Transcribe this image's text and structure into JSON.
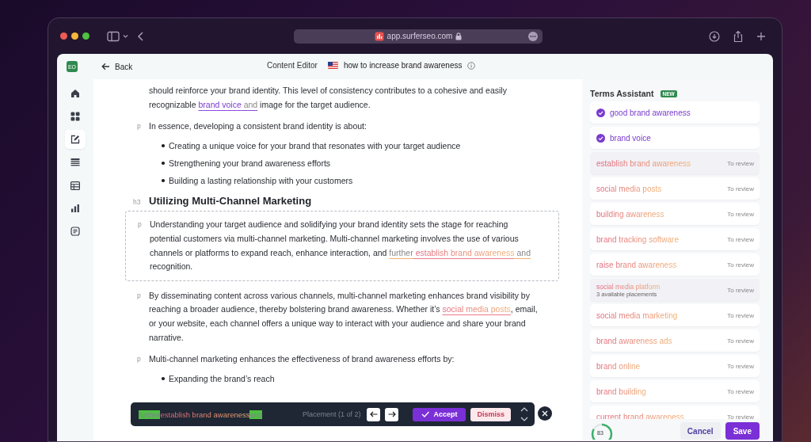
{
  "browser": {
    "url": "app.surferseo.com"
  },
  "header": {
    "badge": "EO",
    "back": "Back",
    "section": "Content Editor",
    "document_title": "how to increase brand awareness"
  },
  "sidebar": {
    "items": [
      {
        "selected": false
      },
      {
        "selected": false
      },
      {
        "selected": true
      },
      {
        "selected": false
      },
      {
        "selected": false
      },
      {
        "selected": false
      },
      {
        "selected": false
      }
    ]
  },
  "editor": {
    "blocks": [
      {
        "kind": "paragraph",
        "focused": false,
        "parts": [
          {
            "text": "should reinforce your brand identity. This level of consistency contributes to a cohesive and easily recognizable ",
            "kind": "plain"
          },
          {
            "text": "brand voice",
            "kind": "accepted"
          },
          {
            "text": " and",
            "kind": "acceptedtail"
          },
          {
            "text": " image for the target audience.",
            "kind": "plain"
          }
        ]
      },
      {
        "kind": "paragraph",
        "tag": "p",
        "focused": false,
        "parts": [
          {
            "text": "In essence, developing a consistent brand identity is about:",
            "kind": "plain"
          }
        ]
      },
      {
        "kind": "list",
        "items": [
          "Creating a unique voice for your brand that resonates with your target audience",
          "Strengthening your brand awareness efforts",
          "Building a lasting relationship with your customers"
        ]
      },
      {
        "kind": "heading",
        "tag": "h3",
        "text": "Utilizing Multi-Channel Marketing"
      },
      {
        "kind": "paragraph",
        "tag": "p",
        "focused": true,
        "parts": [
          {
            "text": "Understanding your target audience and solidifying your brand identity sets the stage for reaching potential customers via multi-channel marketing. Multi-channel marketing involves the use of various channels or platforms to expand reach, enhance interaction, and ",
            "kind": "plain"
          },
          {
            "text": "further",
            "kind": "suggestedtail"
          },
          {
            "text": " establish brand awareness",
            "kind": "suggested"
          },
          {
            "text": " and",
            "kind": "suggestedtail"
          },
          {
            "text": " recognition.",
            "kind": "plain"
          }
        ]
      },
      {
        "kind": "paragraph",
        "tag": "p",
        "focused": false,
        "parts": [
          {
            "text": "By disseminating content across various channels, multi-channel marketing enhances brand visibility by reaching a broader audience, thereby bolstering brand awareness. Whether it’s ",
            "kind": "plain"
          },
          {
            "text": "social media posts",
            "kind": "suggested"
          },
          {
            "text": ", email, or your website, each channel offers a unique way to interact with your audience and share your brand narrative.",
            "kind": "plain"
          }
        ]
      },
      {
        "kind": "paragraph",
        "tag": "p",
        "focused": false,
        "parts": [
          {
            "text": "Multi-channel marketing enhances the effectiveness of brand awareness efforts by:",
            "kind": "plain"
          }
        ]
      },
      {
        "kind": "list",
        "items": [
          "Expanding the brand’s reach"
        ]
      }
    ]
  },
  "placement_bar": {
    "before": "further",
    "term": "establish brand awareness",
    "after": "and",
    "placement": "Placement (1 of 2)",
    "accept": "Accept",
    "dismiss": "Dismiss"
  },
  "terms_assistant": {
    "title": "Terms Assistant",
    "badge": "NEW",
    "terms": [
      {
        "text": "good brand awareness",
        "done": true,
        "selected": false
      },
      {
        "text": "brand voice",
        "done": true,
        "selected": false
      },
      {
        "text": "establish brand awareness",
        "done": false,
        "selected": true,
        "status": "To review"
      },
      {
        "text": "social media posts",
        "done": false,
        "selected": false,
        "status": "To review"
      },
      {
        "text": "building awareness",
        "done": false,
        "selected": false,
        "status": "To review"
      },
      {
        "text": "brand tracking software",
        "done": false,
        "selected": false,
        "status": "To review"
      },
      {
        "text": "raise brand awareness",
        "done": false,
        "selected": false,
        "status": "To review"
      },
      {
        "text": "social media platform",
        "subtitle": "3 available placements",
        "done": false,
        "selected": true,
        "status": "To review"
      },
      {
        "text": "social media marketing",
        "done": false,
        "selected": false,
        "status": "To review"
      },
      {
        "text": "brand awareness ads",
        "done": false,
        "selected": false,
        "status": "To review"
      },
      {
        "text": "brand online",
        "done": false,
        "selected": false,
        "status": "To review"
      },
      {
        "text": "brand building",
        "done": false,
        "selected": false,
        "status": "To review"
      },
      {
        "text": "current brand awareness",
        "done": false,
        "selected": false,
        "status": "To review"
      }
    ],
    "score": "83",
    "cancel": "Cancel",
    "save": "Save"
  }
}
